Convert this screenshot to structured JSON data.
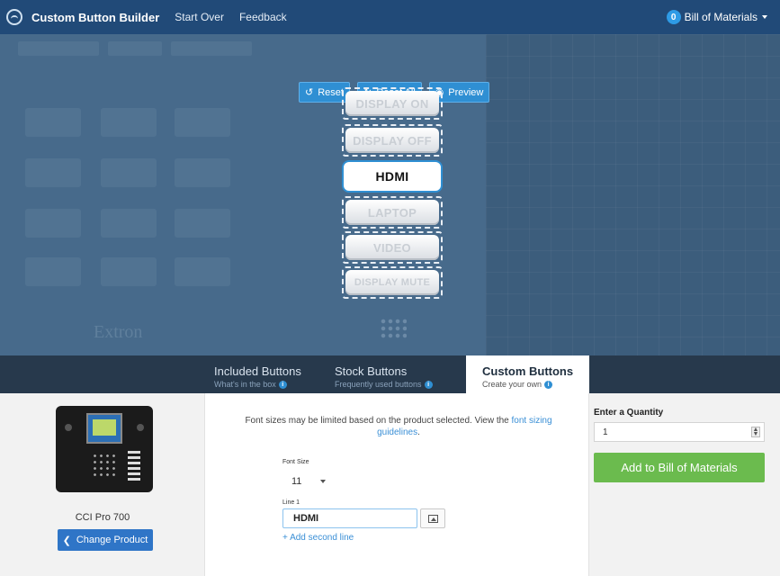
{
  "nav": {
    "brand": "Custom Button Builder",
    "links": [
      "Start Over",
      "Feedback"
    ],
    "bom_count": "0",
    "bom_label": "Bill of Materials"
  },
  "toolbar": {
    "reset": "Reset",
    "reset_all": "Reset All",
    "preview": "Preview"
  },
  "keypad_buttons": [
    {
      "label": "DISPLAY ON",
      "state": "default"
    },
    {
      "label": "DISPLAY OFF",
      "state": "default"
    },
    {
      "label": "HDMI",
      "state": "custom"
    },
    {
      "label": "LAPTOP",
      "state": "default"
    },
    {
      "label": "VIDEO",
      "state": "default"
    },
    {
      "label": "DISPLAY MUTE",
      "state": "default"
    }
  ],
  "stage": {
    "watermark": "Extron"
  },
  "tabs": [
    {
      "label": "Included Buttons",
      "sub": "What's in the box"
    },
    {
      "label": "Stock Buttons",
      "sub": "Frequently used buttons"
    },
    {
      "label": "Custom Buttons",
      "sub": "Create your own"
    }
  ],
  "product": {
    "name": "CCI Pro 700",
    "change_button": "Change Product"
  },
  "editor": {
    "notice_text": "Font sizes may be limited based on the product selected. View the",
    "notice_link": "font sizing guidelines",
    "notice_end": ".",
    "font_size_label": "Font Size",
    "font_size_value": "11",
    "line1_label": "Line 1",
    "line1_value": "HDMI",
    "add_line": "+ Add second line"
  },
  "order": {
    "quantity_label": "Enter a Quantity",
    "quantity_value": "1",
    "add_button": "Add to Bill of Materials"
  },
  "colors": {
    "nav": "#214a78",
    "accent": "#2f8fd3",
    "add_green": "#6bbb4e"
  }
}
